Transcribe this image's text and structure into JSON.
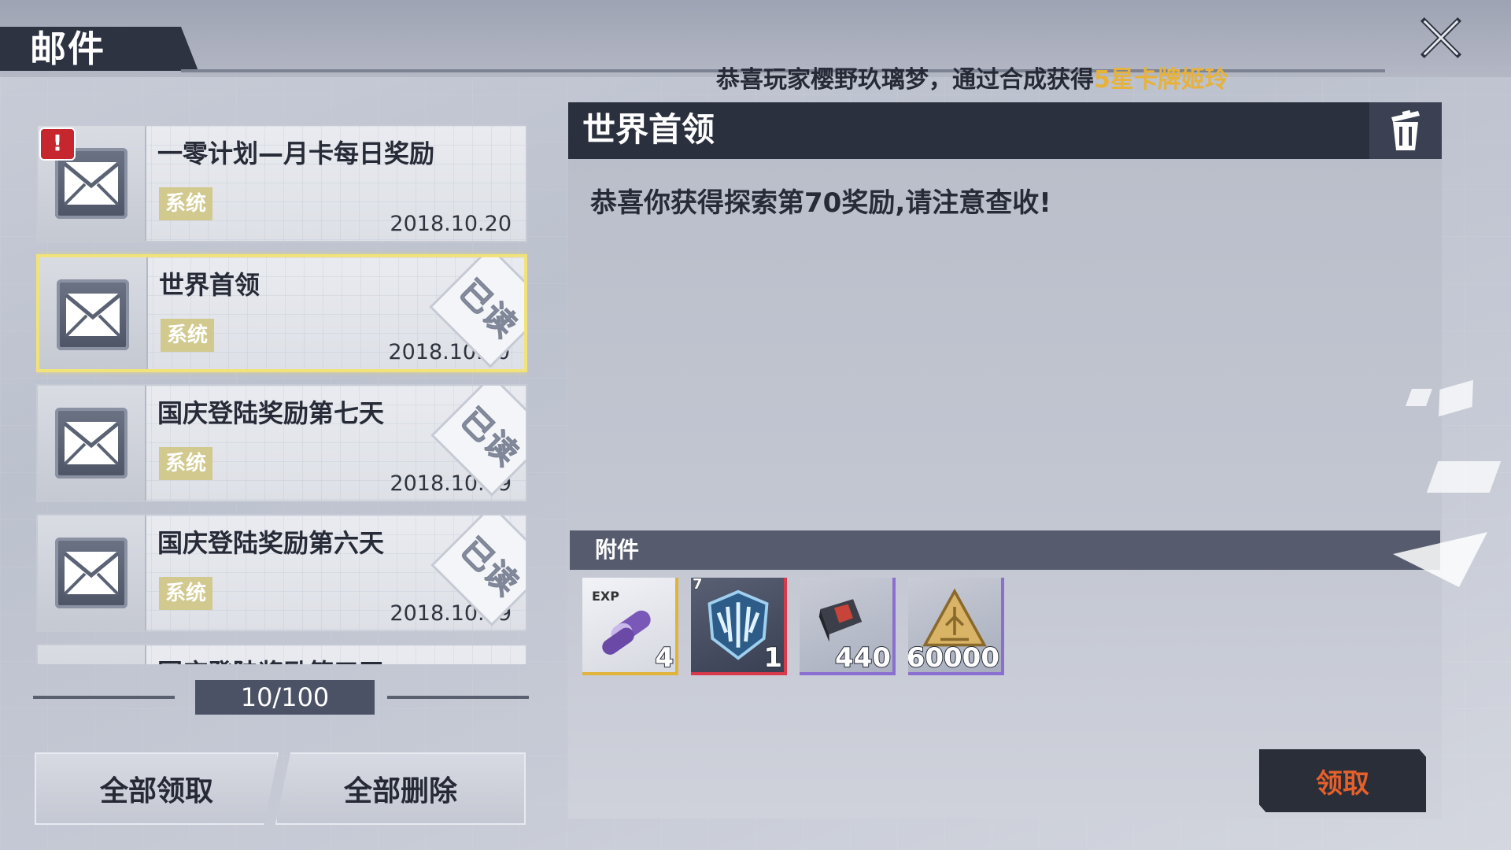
{
  "header": {
    "title": "邮件",
    "broadcast_prefix": "恭喜玩家樱野玖璃梦，通过合成获得",
    "broadcast_highlight": "5星卡牌姬玲",
    "highlight_color": "#e6b23c"
  },
  "mail_list": {
    "items": [
      {
        "title": "一零计划—月卡每日奖励",
        "tag": "系统",
        "date": "2018.10.20",
        "read_label": "",
        "alert": "!"
      },
      {
        "title": "世界首领",
        "tag": "系统",
        "date": "2018.10.20",
        "read_label": "已读"
      },
      {
        "title": "国庆登陆奖励第七天",
        "tag": "系统",
        "date": "2018.10.19",
        "read_label": "已读"
      },
      {
        "title": "国庆登陆奖励第六天",
        "tag": "系统",
        "date": "2018.10.19",
        "read_label": "已读"
      },
      {
        "title": "国庆登陆奖励第五天",
        "tag": "",
        "date": "",
        "read_label": ""
      }
    ],
    "selected_index": 1
  },
  "pager": {
    "text": "10/100"
  },
  "bottom_buttons": {
    "claim_all": "全部领取",
    "delete_all": "全部删除"
  },
  "detail": {
    "title": "世界首领",
    "body": "恭喜你获得探索第70奖励,请注意查收!",
    "attachments_label": "附件",
    "attachments": [
      {
        "icon": "exp-capsule-icon",
        "qty": "4",
        "badge": "EXP",
        "rarity_color": "#e0b33a"
      },
      {
        "icon": "shield-emblem-icon",
        "qty": "1",
        "rank": "7",
        "rarity_color": "#d83a4c"
      },
      {
        "icon": "chip-book-icon",
        "qty": "440",
        "rarity_color": "#8a6fd0"
      },
      {
        "icon": "gold-triangle-icon",
        "qty": "60000",
        "rarity_color": "#8a6fd0"
      }
    ],
    "claim_label": "领取"
  }
}
